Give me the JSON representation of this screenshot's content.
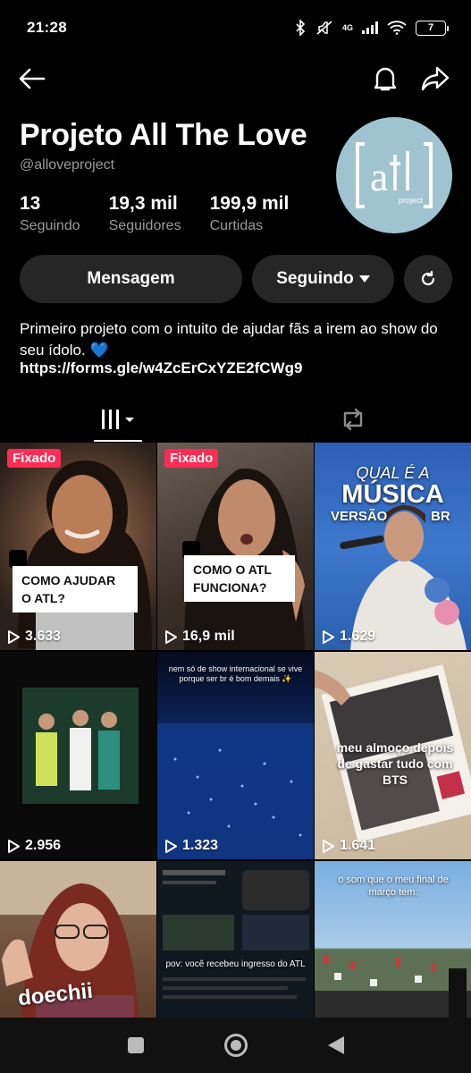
{
  "status_bar": {
    "time": "21:28",
    "network": "4G",
    "battery": "7"
  },
  "profile": {
    "name": "Projeto All The Love",
    "handle": "@alloveproject",
    "avatar_label": "project",
    "stats": [
      {
        "value": "13",
        "label": "Seguindo"
      },
      {
        "value": "19,3 mil",
        "label": "Seguidores"
      },
      {
        "value": "199,9 mil",
        "label": "Curtidas"
      }
    ],
    "bio": "Primeiro projeto com o intuito de ajudar fãs a irem ao show do seu ídolo. 💙",
    "link": "https://forms.gle/w4ZcErCxYZE2fCWg9"
  },
  "actions": {
    "message": "Mensagem",
    "following": "Seguindo"
  },
  "colors": {
    "background": "#000000",
    "button": "#262626",
    "pin": "#fe2c55",
    "avatar": "#9fc4cf"
  },
  "videos": [
    {
      "views": "3.633",
      "pinned": "Fixado",
      "caption": "COMO AJUDAR O ATL?"
    },
    {
      "views": "16,9 mil",
      "pinned": "Fixado",
      "caption": "COMO O ATL FUNCIONA?"
    },
    {
      "views": "1.629",
      "title_line1": "QUAL É A",
      "title_line2": "MÚSICA",
      "title_line3": "VERSÃO",
      "title_line3b": "BR"
    },
    {
      "views": "2.956"
    },
    {
      "views": "1.323",
      "overlay": "nem só de show internacional se vive porque ser br é bom demais ✨"
    },
    {
      "views": "1.641",
      "overlay": "meu almoço depois de gastar tudo com BTS"
    },
    {
      "views": "",
      "overlay": "doechii"
    },
    {
      "views": "",
      "overlay": "pov: você recebeu ingresso do ATL"
    },
    {
      "views": "",
      "overlay": "o som que o meu final de março tem:"
    }
  ]
}
